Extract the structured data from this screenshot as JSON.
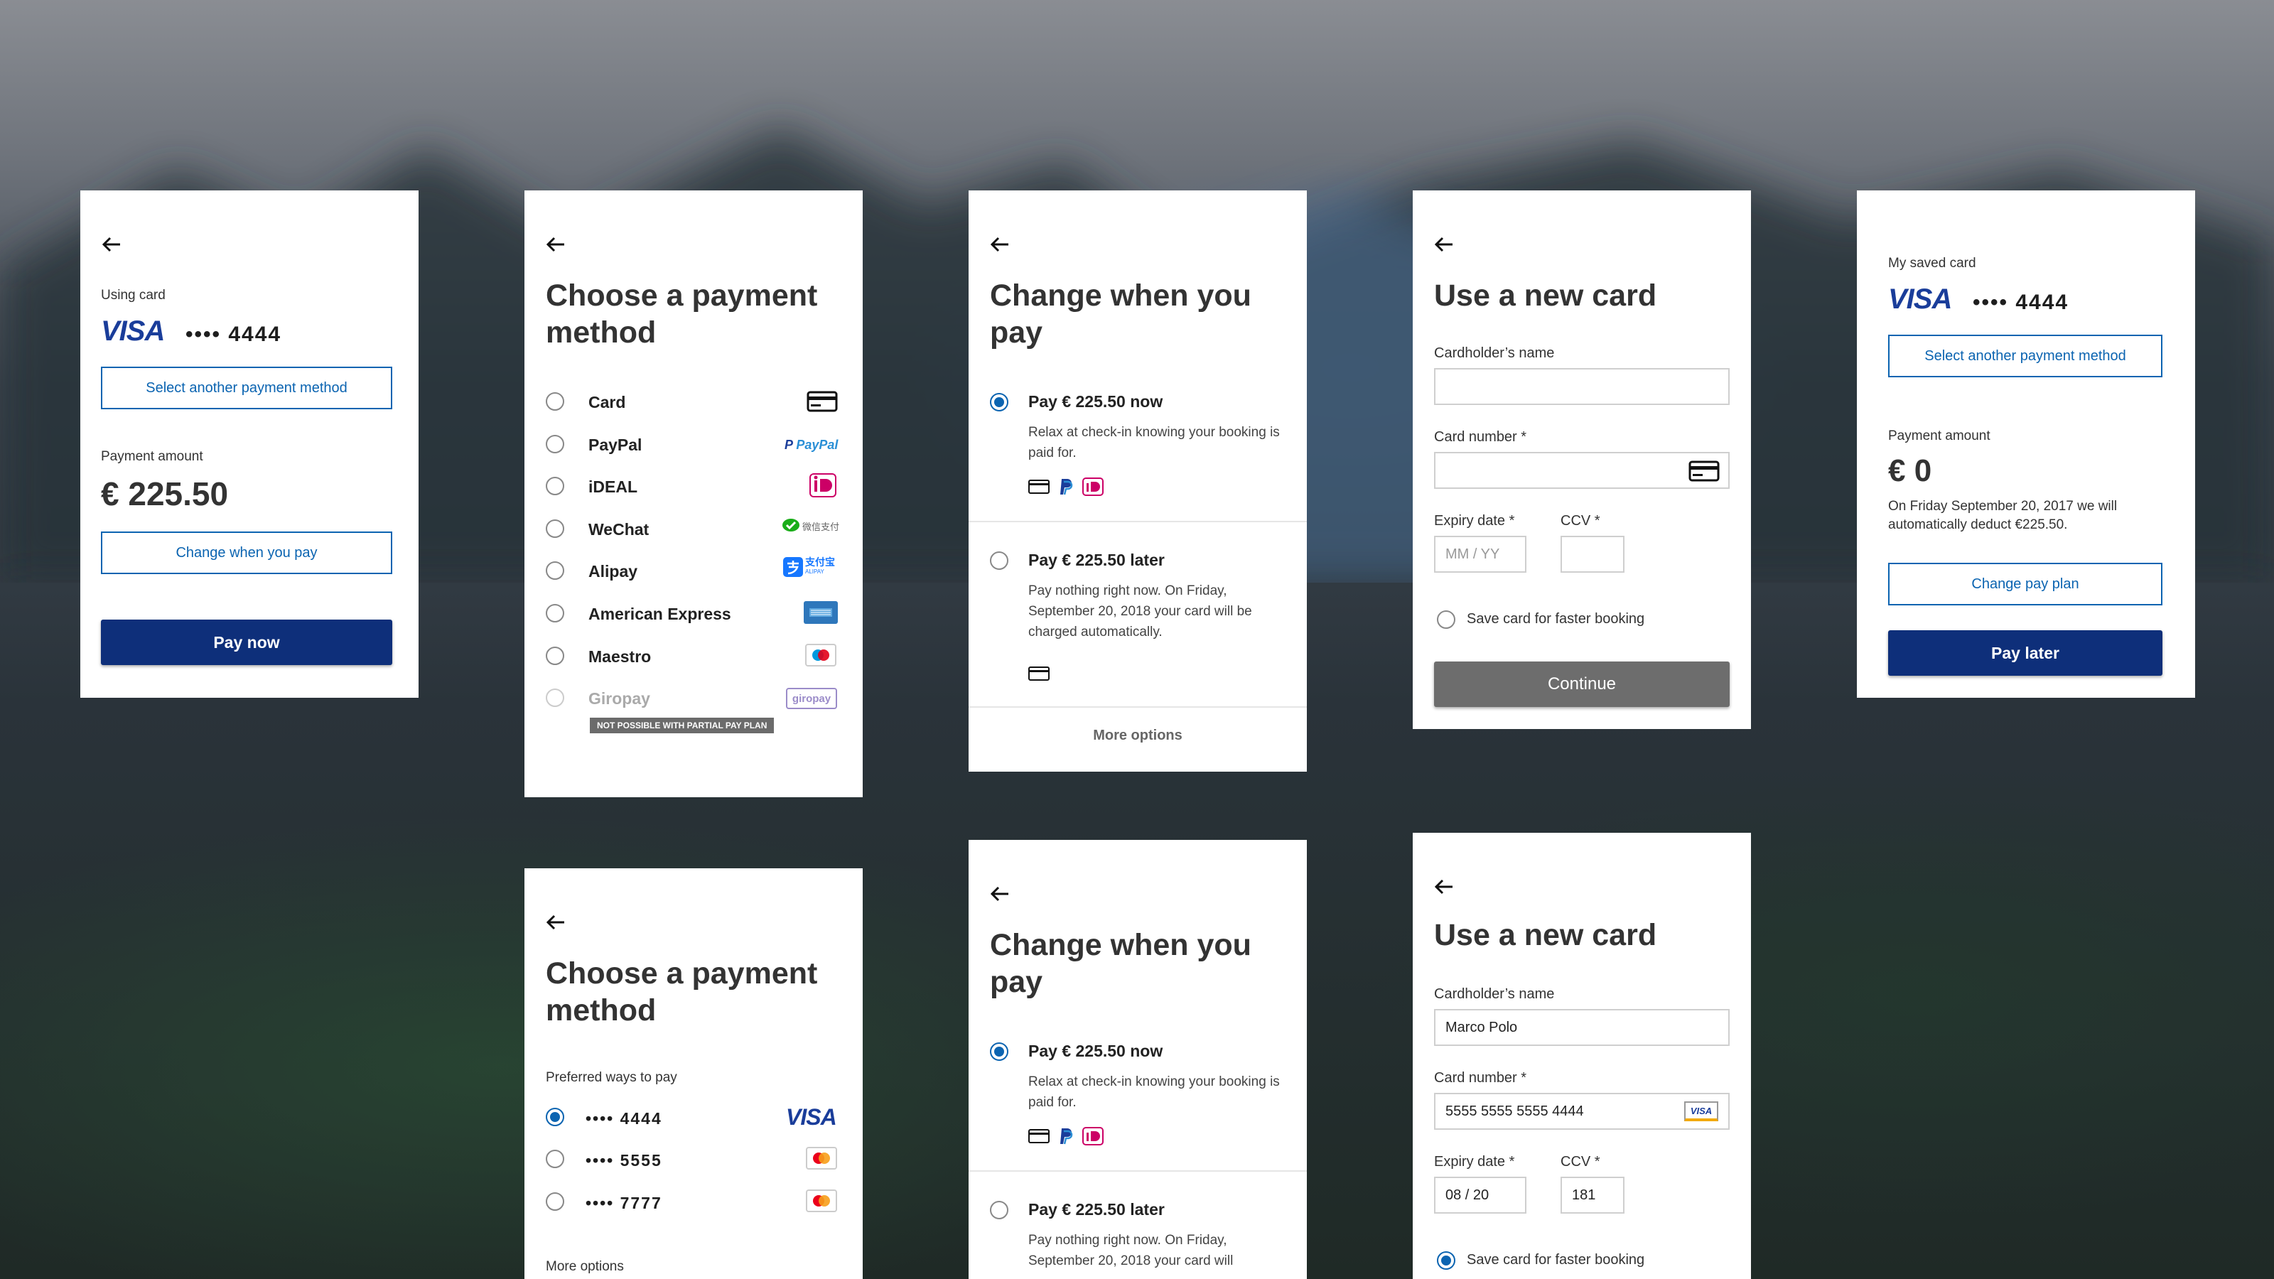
{
  "common": {
    "back_icon": "arrow-left-icon",
    "card_icon": "credit-card-icon"
  },
  "screen1": {
    "using_card": "Using card",
    "visa": "VISA",
    "card_masked": "•••• 4444",
    "select_other": "Select another payment method",
    "payment_amount_label": "Payment amount",
    "amount": "€ 225.50",
    "change_when": "Change when you pay",
    "pay_now": "Pay now"
  },
  "screen2": {
    "title": "Choose a payment method",
    "options": [
      {
        "label": "Card",
        "icon": "credit-card-icon"
      },
      {
        "label": "PayPal",
        "icon": "paypal-logo"
      },
      {
        "label": "iDEAL",
        "icon": "ideal-logo"
      },
      {
        "label": "WeChat",
        "icon": "wechat-pay-logo"
      },
      {
        "label": "Alipay",
        "icon": "alipay-logo"
      },
      {
        "label": "American Express",
        "icon": "amex-logo"
      },
      {
        "label": "Maestro",
        "icon": "maestro-logo"
      },
      {
        "label": "Giropay",
        "icon": "giropay-logo"
      }
    ],
    "paypal_logo_text": "PayPal",
    "wechat_logo_text": "微信支付",
    "alipay_logo_text": "支付宝",
    "alipay_sub": "ALIPAY",
    "giropay_logo_text": "giropay",
    "not_possible": "NOT POSSIBLE WITH PARTIAL PAY PLAN"
  },
  "screen3": {
    "title": "Change when you pay",
    "now_title": "Pay € 225.50 now",
    "now_desc": "Relax at check-in knowing your booking is paid for.",
    "later_title": "Pay € 225.50 later",
    "later_desc": "Pay nothing right now. On Friday, September 20, 2018 your card will be charged automatically.",
    "more_options": "More options"
  },
  "screen4": {
    "title": "Use a new card",
    "name_label": "Cardholder’s name",
    "number_label": "Card number *",
    "expiry_label": "Expiry date *",
    "expiry_placeholder": "MM / YY",
    "ccv_label": "CCV *",
    "save_label": "Save card for faster booking",
    "continue": "Continue"
  },
  "screen5": {
    "saved_label": "My saved card",
    "visa": "VISA",
    "card_masked": "•••• 4444",
    "select_other": "Select another payment method",
    "payment_amount_label": "Payment amount",
    "amount": "€ 0",
    "note": "On Friday September 20, 2017 we will automatically deduct €225.50.",
    "change_plan": "Change pay plan",
    "pay_later": "Pay later"
  },
  "screen6": {
    "title": "Choose a payment method",
    "preferred": "Preferred ways to pay",
    "cards": [
      {
        "masked": "•••• 4444",
        "brand": "visa-logo"
      },
      {
        "masked": "•••• 5555",
        "brand": "mastercard-logo"
      },
      {
        "masked": "•••• 7777",
        "brand": "mastercard-logo"
      }
    ],
    "visa": "VISA",
    "more_options": "More options"
  },
  "screen7": {
    "title": "Change when you pay",
    "now_title": "Pay € 225.50 now",
    "now_desc": "Relax at check-in knowing your booking is paid for.",
    "later_title": "Pay € 225.50 later",
    "later_desc": "Pay nothing right now. On Friday, September 20, 2018 your card will"
  },
  "screen8": {
    "title": "Use a new card",
    "name_label": "Cardholder’s name",
    "name_value": "Marco Polo",
    "number_label": "Card number *",
    "number_value": "5555 5555 5555 4444",
    "visa_mini": "VISA",
    "expiry_label": "Expiry date *",
    "expiry_value": "08 / 20",
    "ccv_label": "CCV *",
    "ccv_value": "181",
    "save_label": "Save card for faster booking"
  }
}
